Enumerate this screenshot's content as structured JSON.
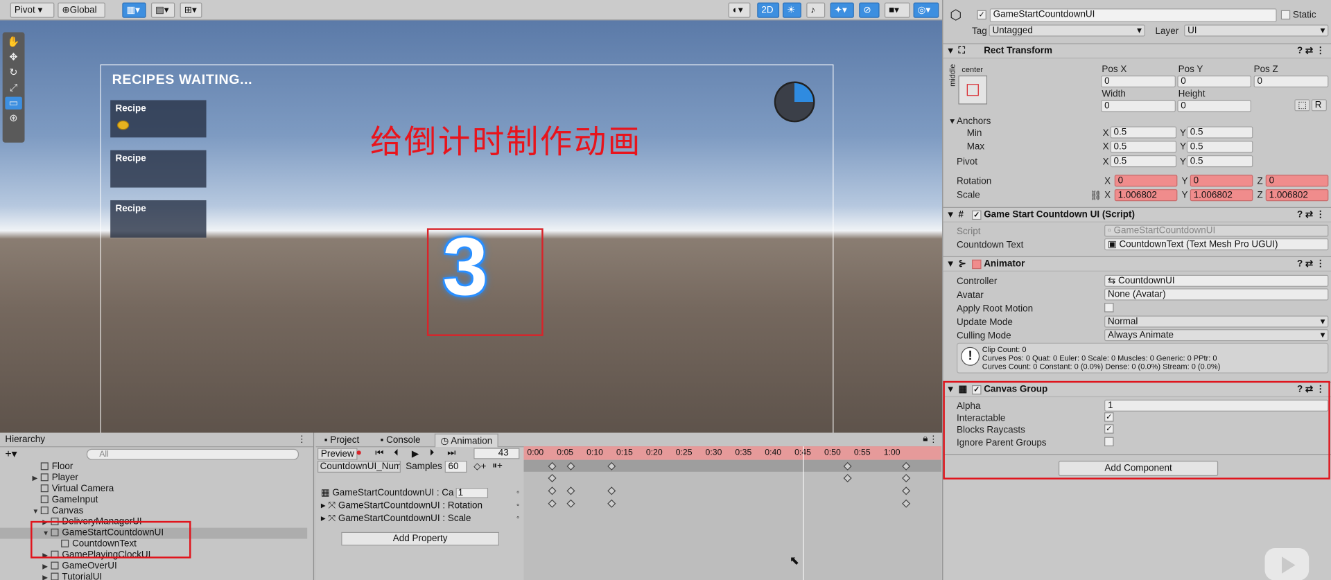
{
  "scene_toolbar": {
    "pivot_label": "Pivot",
    "global_label": "Global",
    "mode_2d": "2D"
  },
  "scene": {
    "recipes_title": "RECIPES WAITING...",
    "recipe_cards": [
      {
        "label": "Recipe"
      },
      {
        "label": "Recipe"
      },
      {
        "label": "Recipe"
      }
    ],
    "annotation": "给倒计时制作动画",
    "countdown_digit": "3"
  },
  "hierarchy": {
    "title": "Hierarchy",
    "search_placeholder": "All",
    "items": [
      {
        "label": "Floor",
        "depth": 1,
        "expandable": false
      },
      {
        "label": "Player",
        "depth": 1,
        "expandable": true
      },
      {
        "label": "Virtual Camera",
        "depth": 1,
        "expandable": false
      },
      {
        "label": "GameInput",
        "depth": 1,
        "expandable": false
      },
      {
        "label": "Canvas",
        "depth": 1,
        "expandable": true,
        "expanded": true
      },
      {
        "label": "DeliveryManagerUI",
        "depth": 2,
        "expandable": true
      },
      {
        "label": "GameStartCountdownUI",
        "depth": 2,
        "expandable": true,
        "expanded": true,
        "selected": true
      },
      {
        "label": "CountdownText",
        "depth": 3,
        "expandable": false
      },
      {
        "label": "GamePlayingClockUI",
        "depth": 2,
        "expandable": true
      },
      {
        "label": "GameOverUI",
        "depth": 2,
        "expandable": true
      },
      {
        "label": "TutorialUI",
        "depth": 2,
        "expandable": true
      }
    ]
  },
  "bottom_tabs": [
    {
      "label": "Project"
    },
    {
      "label": "Console"
    },
    {
      "label": "Animation",
      "active": true
    }
  ],
  "animation": {
    "preview_label": "Preview",
    "frame": "43",
    "clip_name": "CountdownUI_Num",
    "samples_label": "Samples",
    "samples_value": "60",
    "ruler_ticks": [
      "0:00",
      "0:05",
      "0:10",
      "0:15",
      "0:20",
      "0:25",
      "0:30",
      "0:35",
      "0:40",
      "0:45",
      "0:50",
      "0:55",
      "1:00"
    ],
    "properties": [
      {
        "label": "GameStartCountdownUI : Ca",
        "value": "1"
      },
      {
        "label": "GameStartCountdownUI : Rotation"
      },
      {
        "label": "GameStartCountdownUI : Scale"
      }
    ],
    "add_property_label": "Add Property"
  },
  "inspector": {
    "object_name": "GameStartCountdownUI",
    "static_label": "Static",
    "tag_label": "Tag",
    "tag_value": "Untagged",
    "layer_label": "Layer",
    "layer_value": "UI",
    "rect_transform": {
      "title": "Rect Transform",
      "anchor_preset_top": "center",
      "anchor_preset_side": "middle",
      "pos_x_label": "Pos X",
      "pos_x": "0",
      "pos_y_label": "Pos Y",
      "pos_y": "0",
      "pos_z_label": "Pos Z",
      "pos_z": "0",
      "width_label": "Width",
      "width": "0",
      "height_label": "Height",
      "height": "0",
      "r_label": "R",
      "anchors_label": "Anchors",
      "min_label": "Min",
      "min_x": "0.5",
      "min_y": "0.5",
      "max_label": "Max",
      "max_x": "0.5",
      "max_y": "0.5",
      "pivot_label": "Pivot",
      "pivot_x": "0.5",
      "pivot_y": "0.5",
      "rotation_label": "Rotation",
      "rot_x": "0",
      "rot_y": "0",
      "rot_z": "0",
      "scale_label": "Scale",
      "scale_x": "1.006802",
      "scale_y": "1.006802",
      "scale_z": "1.006802",
      "axis_x": "X",
      "axis_y": "Y",
      "axis_z": "Z"
    },
    "script_component": {
      "title": "Game Start Countdown UI (Script)",
      "script_label": "Script",
      "script_value": "GameStartCountdownUI",
      "countdown_text_label": "Countdown Text",
      "countdown_text_value": "CountdownText (Text Mesh Pro UGUI)"
    },
    "animator": {
      "title": "Animator",
      "controller_label": "Controller",
      "controller_value": "CountdownUI",
      "avatar_label": "Avatar",
      "avatar_value": "None (Avatar)",
      "apply_root_motion_label": "Apply Root Motion",
      "update_mode_label": "Update Mode",
      "update_mode_value": "Normal",
      "culling_mode_label": "Culling Mode",
      "culling_mode_value": "Always Animate",
      "info_line1": "Clip Count: 0",
      "info_line2": "Curves Pos: 0 Quat: 0 Euler: 0 Scale: 0 Muscles: 0 Generic: 0 PPtr: 0",
      "info_line3": "Curves Count: 0 Constant: 0 (0.0%) Dense: 0 (0.0%) Stream: 0 (0.0%)"
    },
    "canvas_group": {
      "title": "Canvas Group",
      "alpha_label": "Alpha",
      "alpha_value": "1",
      "interactable_label": "Interactable",
      "blocks_raycasts_label": "Blocks Raycasts",
      "ignore_parent_label": "Ignore Parent Groups"
    },
    "add_component_label": "Add Component"
  },
  "colors": {
    "selection_blue": "#3d8fe0",
    "annotation_red": "#e8141c",
    "animated_field": "#f08c8c",
    "timeline_red": "#e69a9a"
  }
}
